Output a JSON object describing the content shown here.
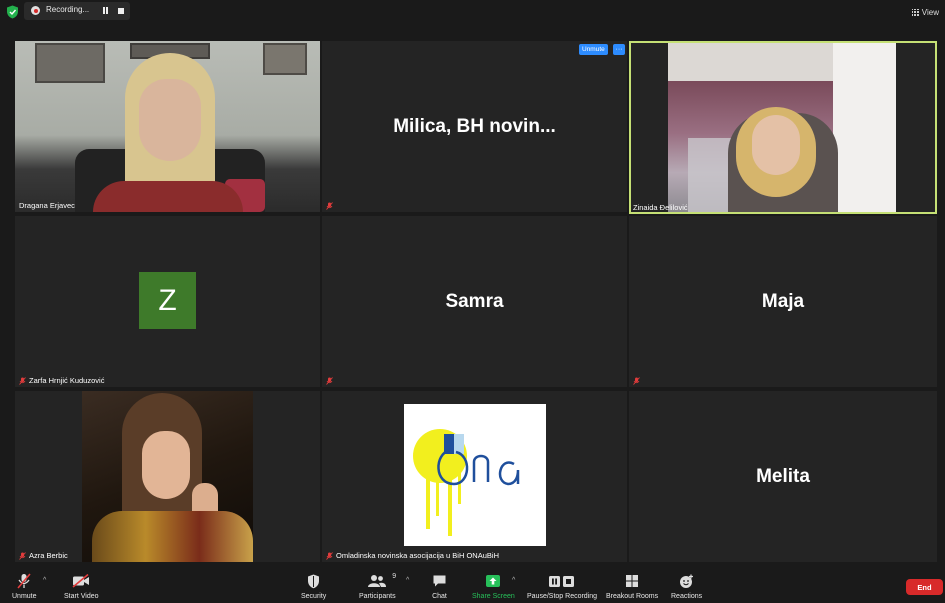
{
  "topbar": {
    "recording_label": "Recording...",
    "view_label": "View"
  },
  "tiles": [
    {
      "name": "Dragana Erjavec",
      "muted": false
    },
    {
      "name": "",
      "display_name": "Milica, BH novin...",
      "muted": true,
      "unmute_label": "Unmute",
      "more_label": "···"
    },
    {
      "name": "Zinaida Đelilović",
      "muted": false,
      "active": true
    },
    {
      "name": "Zarfa Hrnjić Kuduzović",
      "muted": true,
      "avatar_letter": "Z"
    },
    {
      "name": "",
      "display_name": "Samra",
      "muted": true
    },
    {
      "name": "",
      "display_name": "Maja",
      "muted": true
    },
    {
      "name": "Azra Berbic",
      "muted": true
    },
    {
      "name": "Omladinska novinska asocijacija u BiH ONAuBiH",
      "muted": true,
      "logo_text": "ona"
    },
    {
      "name": "",
      "display_name": "Melita",
      "muted": false
    }
  ],
  "toolbar": {
    "unmute": "Unmute",
    "start_video": "Start Video",
    "security": "Security",
    "participants": "Participants",
    "participants_count": "9",
    "chat": "Chat",
    "share_screen": "Share Screen",
    "pause_stop_recording": "Pause/Stop Recording",
    "breakout_rooms": "Breakout Rooms",
    "reactions": "Reactions",
    "end": "End"
  },
  "colors": {
    "accent_green": "#27c05a",
    "active_speaker": "#c5e075",
    "end_red": "#d82a2a",
    "unmute_blue": "#2d8cff",
    "avatar_green": "#3e7a2a"
  }
}
